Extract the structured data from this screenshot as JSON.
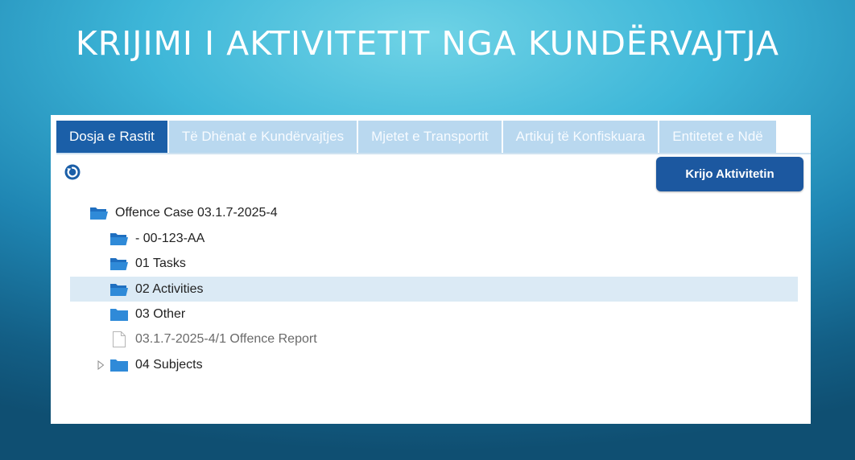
{
  "slide": {
    "title": "KRIJIMI I AKTIVITETIT NGA KUNDËRVAJTJA"
  },
  "tabs": [
    {
      "label": "Dosja e Rastit",
      "active": true
    },
    {
      "label": "Të Dhënat e Kundërvajtjes",
      "active": false
    },
    {
      "label": "Mjetet e Transportit",
      "active": false
    },
    {
      "label": "Artikuj të Konfiskuara",
      "active": false
    },
    {
      "label": "Entitetet e Ndë",
      "active": false
    }
  ],
  "toolbar": {
    "refresh_icon": "refresh-icon",
    "create_activity_label": "Krijo Aktivitetin"
  },
  "tree": {
    "root": {
      "label": "Offence Case 03.1.7-2025-4",
      "icon": "folder-open-icon"
    },
    "children": [
      {
        "label": "- 00-123-AA",
        "icon": "folder-open-icon",
        "selected": false
      },
      {
        "label": "01 Tasks",
        "icon": "folder-open-icon",
        "selected": false
      },
      {
        "label": "02 Activities",
        "icon": "folder-open-icon",
        "selected": true
      },
      {
        "label": "03 Other",
        "icon": "folder-icon",
        "selected": false
      },
      {
        "label": "03.1.7-2025-4/1 Offence Report",
        "icon": "file-icon",
        "selected": false
      },
      {
        "label": "04 Subjects",
        "icon": "folder-icon",
        "collapsed": true,
        "selected": false
      }
    ]
  },
  "colors": {
    "tab_active": "#1b5fa8",
    "tab_inactive": "#b9d8ef",
    "button": "#1c58a0",
    "folder": "#2f8ad8",
    "selected_row": "#dbeaf5"
  }
}
